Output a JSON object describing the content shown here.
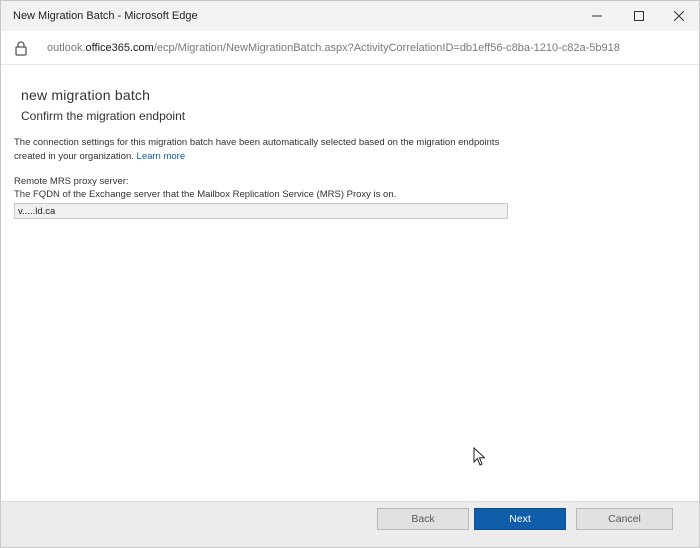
{
  "window": {
    "title": "New Migration Batch - Microsoft Edge"
  },
  "addressbar": {
    "url_prefix": "outlook.",
    "url_domain": "office365.com",
    "url_path": "/ecp/Migration/NewMigrationBatch.aspx?ActivityCorrelationID=db1eff56-c8ba-1210-c82a-5b918"
  },
  "page": {
    "title": "new migration batch",
    "subtitle": "Confirm the migration endpoint",
    "description": "The connection settings for this migration batch have been automatically selected based on the migration endpoints created in your organization.",
    "learn_more": "Learn more",
    "field_label": "Remote MRS proxy server:",
    "field_help": "The FQDN of the Exchange server that the Mailbox Replication Service (MRS) Proxy is on.",
    "field_value": "v.....ld.ca"
  },
  "footer": {
    "back": "Back",
    "next": "Next",
    "cancel": "Cancel"
  },
  "colors": {
    "accent": "#0f5da8"
  }
}
